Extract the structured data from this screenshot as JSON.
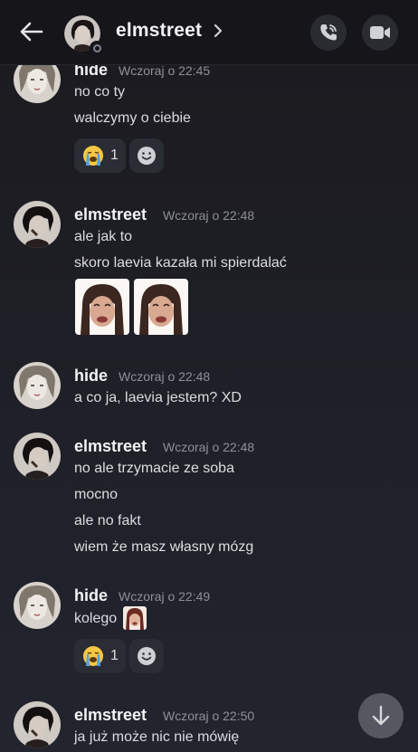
{
  "header": {
    "title": "elmstreet"
  },
  "messages": [
    {
      "author": "hide",
      "timestamp": "Wczoraj o 22:45",
      "lines": [
        "no co ty",
        "walczymy o ciebie"
      ],
      "reaction": {
        "emoji": "loudly-crying-face",
        "count": "1"
      }
    },
    {
      "author": "elmstreet",
      "timestamp": "Wczoraj o 22:48",
      "lines": [
        "ale jak to",
        "skoro laevia kazała mi spierdalać"
      ]
    },
    {
      "author": "hide",
      "timestamp": "Wczoraj o 22:48",
      "lines": [
        "a co ja, laevia jestem? XD"
      ]
    },
    {
      "author": "elmstreet",
      "timestamp": "Wczoraj o 22:48",
      "lines": [
        "no ale trzymacie ze soba",
        "mocno",
        "ale no fakt",
        "wiem że masz własny mózg"
      ]
    },
    {
      "author": "hide",
      "timestamp": "Wczoraj o 22:49",
      "lines": [
        "kolego"
      ],
      "reaction": {
        "emoji": "loudly-crying-face",
        "count": "1"
      }
    },
    {
      "author": "elmstreet",
      "timestamp": "Wczoraj o 22:50",
      "lines": [
        "ja już może nic nie mówię"
      ]
    }
  ],
  "colors": {
    "background": "#1e1f26",
    "header": "#15151a",
    "reaction_bg": "#2b2d34",
    "timestamp": "#8e9099"
  }
}
